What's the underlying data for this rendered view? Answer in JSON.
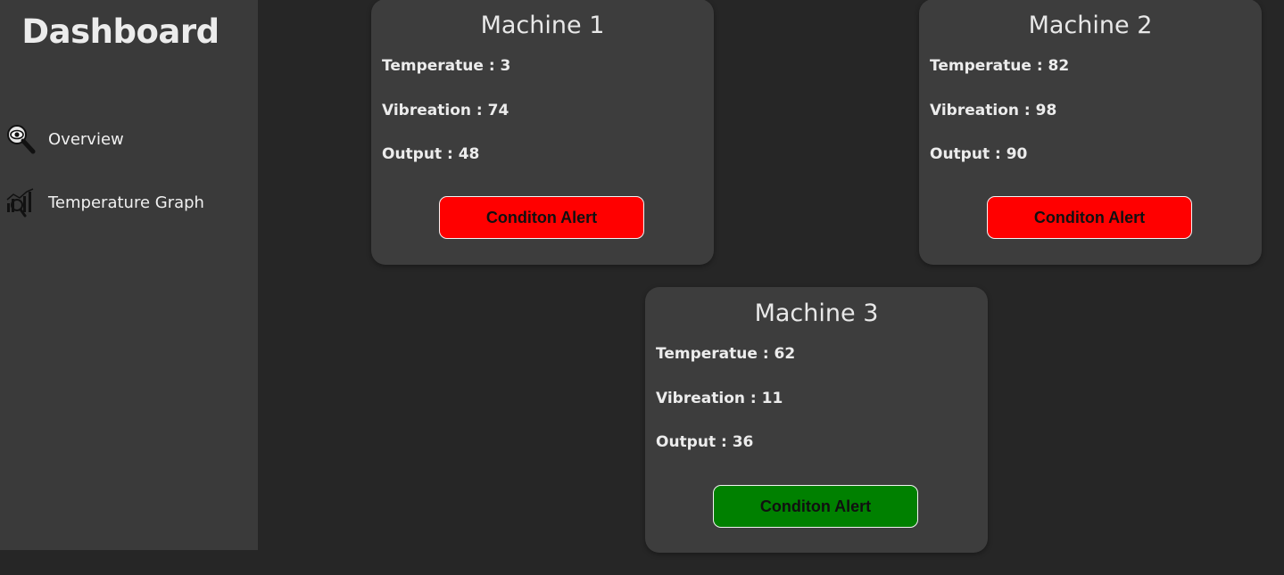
{
  "sidebar": {
    "title": "Dashboard",
    "items": [
      {
        "label": "Overview",
        "icon": "magnifier-eye-icon"
      },
      {
        "label": "Temperature Graph",
        "icon": "chart-magnifier-icon"
      }
    ]
  },
  "machines": [
    {
      "name": "Machine 1",
      "temperature": "Temperatue : 3",
      "vibration": "Vibreation : 74",
      "output": "Output : 48",
      "alert_label": "Conditon Alert",
      "alert_color": "#ff0000"
    },
    {
      "name": "Machine 2",
      "temperature": "Temperatue : 82",
      "vibration": "Vibreation : 98",
      "output": "Output : 90",
      "alert_label": "Conditon Alert",
      "alert_color": "#ff0000"
    },
    {
      "name": "Machine 3",
      "temperature": "Temperatue : 62",
      "vibration": "Vibreation : 11",
      "output": "Output : 36",
      "alert_label": "Conditon Alert",
      "alert_color": "#008000"
    }
  ],
  "colors": {
    "page_background": "#262626",
    "sidebar_background": "#3a3a3a",
    "card_background": "#3d3d3d"
  }
}
